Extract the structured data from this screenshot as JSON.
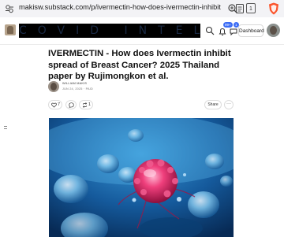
{
  "browser": {
    "url": "makisw.substack.com/p/ivermectin-how-does-ivermectin-inhibit",
    "tab_count": "1"
  },
  "header": {
    "banner_text": "COVID INTEL",
    "notification_badge_1": "99+",
    "notification_badge_2": "1",
    "dashboard_label": "Dashboard"
  },
  "post": {
    "title": "IVERMECTIN - How does Ivermectin inhibit spread of Breast Cancer? 2025 Thailand paper by Rujimongkon et al.",
    "author": "WILLIAM MAKIS",
    "date": "JUN 24, 2025 · PAID",
    "likes": "7",
    "restacks": "1",
    "share_label": "Share",
    "more_label": "···"
  },
  "colors": {
    "accent": "#3b6cf5",
    "hero_bg": "#0c3f7a",
    "tumor": "#e0245e"
  },
  "icons": [
    "url-settings-icon",
    "zoom-icon",
    "reader-view-icon",
    "tab-count-icon",
    "brave-shield-icon",
    "search-icon",
    "notifications-icon",
    "chat-icon",
    "heart-icon",
    "comment-icon",
    "restack-icon",
    "more-icon"
  ]
}
